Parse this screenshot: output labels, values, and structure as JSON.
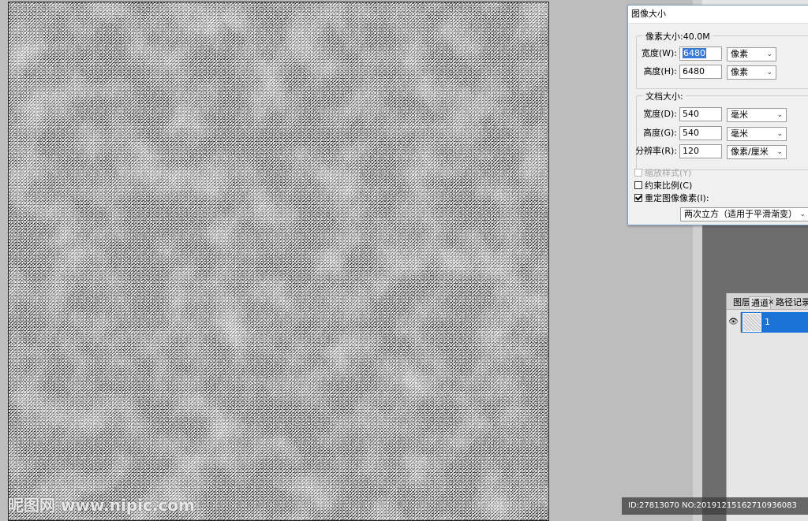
{
  "dialog": {
    "title": "图像大小",
    "pixel_dimensions": {
      "legend": "像素大小:40.0M",
      "width_label": "宽度(W):",
      "width_value": "6480",
      "width_unit": "像素",
      "height_label": "高度(H):",
      "height_value": "6480",
      "height_unit": "像素"
    },
    "document_size": {
      "legend": "文档大小:",
      "width_label": "宽度(D):",
      "width_value": "540",
      "width_unit": "毫米",
      "height_label": "高度(G):",
      "height_value": "540",
      "height_unit": "毫米",
      "resolution_label": "分辨率(R):",
      "resolution_value": "120",
      "resolution_unit": "像素/厘米"
    },
    "options": {
      "scale_styles_label": "缩放样式(Y)",
      "constrain_label": "约束比例(C)",
      "resample_label": "重定图像像素(I):",
      "resample_method": "两次立方（适用于平滑渐变）"
    }
  },
  "layers_panel": {
    "tabs": [
      "图层",
      "通道",
      "×",
      "路径",
      "记录"
    ],
    "layer_name": "1"
  },
  "watermark": {
    "left_text": "昵图网 www.nipic.com",
    "id_text": "ID:27813070 NO:20191215162710936083"
  },
  "colors": {
    "selection_blue": "#1a72d6",
    "canvas_texture": "#e9e9e9"
  }
}
